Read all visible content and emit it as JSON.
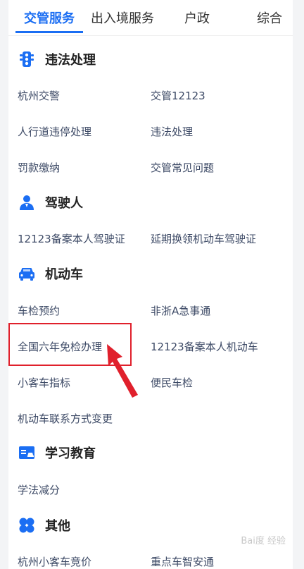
{
  "tabs": [
    {
      "label": "交管服务",
      "active": true
    },
    {
      "label": "出入境服务",
      "active": false
    },
    {
      "label": "户政",
      "active": false
    },
    {
      "label": "综合",
      "active": false
    }
  ],
  "sections": {
    "violation": {
      "title": "违法处理",
      "icon": "traffic-light-icon",
      "items": [
        "杭州交警",
        "交管12123",
        "人行道违停处理",
        "违法处理",
        "罚款缴纳",
        "交管常见问题"
      ]
    },
    "driver": {
      "title": "驾驶人",
      "icon": "driver-icon",
      "items": [
        "12123备案本人驾驶证",
        "延期换领机动车驾驶证"
      ]
    },
    "vehicle": {
      "title": "机动车",
      "icon": "car-icon",
      "items": [
        "车检预约",
        "非浙A急事通",
        "全国六年免检办理",
        "12123备案本人机动车",
        "小客车指标",
        "便民车检",
        "机动车联系方式变更"
      ]
    },
    "education": {
      "title": "学习教育",
      "icon": "id-card-icon",
      "items": [
        "学法减分"
      ]
    },
    "other": {
      "title": "其他",
      "icon": "four-petal-icon",
      "items": [
        "杭州小客车竞价",
        "重点车智安通"
      ]
    }
  },
  "colors": {
    "accent": "#1b6ef3",
    "highlight": "#e0202c"
  },
  "watermark": "Bai度 经验"
}
